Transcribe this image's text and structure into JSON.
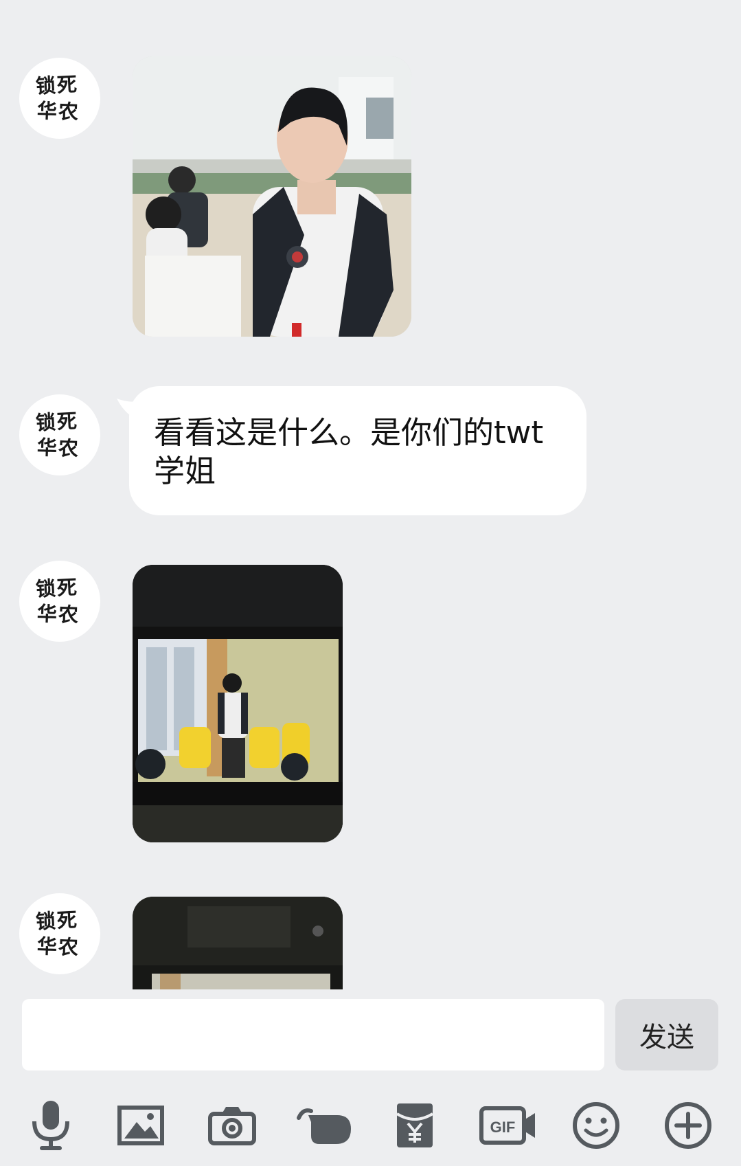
{
  "contact": {
    "avatar_line1": "锁死",
    "avatar_line2": "华农"
  },
  "messages": [
    {
      "type": "image",
      "description_icon": "photo-icon"
    },
    {
      "type": "text",
      "text": "看看这是什么。是你们的twt学姐"
    },
    {
      "type": "image",
      "description_icon": "photo-icon"
    },
    {
      "type": "image",
      "description_icon": "photo-icon"
    }
  ],
  "composer": {
    "input_value": "",
    "send_label": "发送"
  },
  "toolbar": {
    "gif_label": "GIF",
    "items": [
      "microphone-icon",
      "image-icon",
      "camera-icon",
      "poke-icon",
      "red-packet-icon",
      "gif-icon",
      "emoji-icon",
      "plus-icon"
    ]
  },
  "colors": {
    "background": "#edeef0",
    "bubble": "#ffffff",
    "send_button": "#dcdde0",
    "icon": "#555a5f"
  }
}
